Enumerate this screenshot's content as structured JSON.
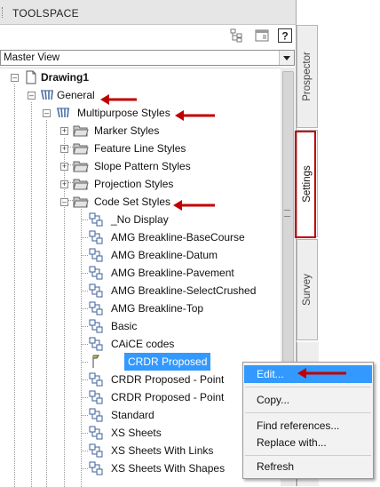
{
  "panel": {
    "title": "TOOLSPACE"
  },
  "view_selector": {
    "value": "Master View"
  },
  "tree": {
    "root": "Drawing1",
    "general": "General",
    "multipurpose": "Multipurpose Styles",
    "folders": [
      "Marker Styles",
      "Feature Line Styles",
      "Slope Pattern Styles",
      "Projection Styles",
      "Code Set Styles"
    ],
    "code_set_items": [
      "_No Display",
      "AMG Breakline-BaseCourse",
      "AMG Breakline-Datum",
      "AMG Breakline-Pavement",
      "AMG Breakline-SelectCrushed",
      "AMG Breakline-Top",
      "Basic",
      "CAiCE codes",
      "CRDR Proposed",
      "CRDR Proposed - Point",
      "CRDR Proposed - Point",
      "Standard",
      "XS Sheets",
      "XS Sheets With Links",
      "XS Sheets With Shapes"
    ],
    "selected_item": "CRDR Proposed"
  },
  "side_tabs": [
    "Prospector",
    "Settings",
    "Survey"
  ],
  "active_tab": "Settings",
  "context_menu": {
    "items": [
      "Edit...",
      "Copy...",
      "Find references...",
      "Replace with...",
      "Refresh"
    ],
    "highlighted": "Edit..."
  },
  "colors": {
    "selection": "#3399ff",
    "annotation_red": "#c00000"
  },
  "icons": [
    "grip-icon",
    "tree-view-icon",
    "panel-icon",
    "help-icon",
    "drawing-icon",
    "style-collection-icon",
    "folder-icon",
    "style-item-icon",
    "arrow-annotation"
  ]
}
